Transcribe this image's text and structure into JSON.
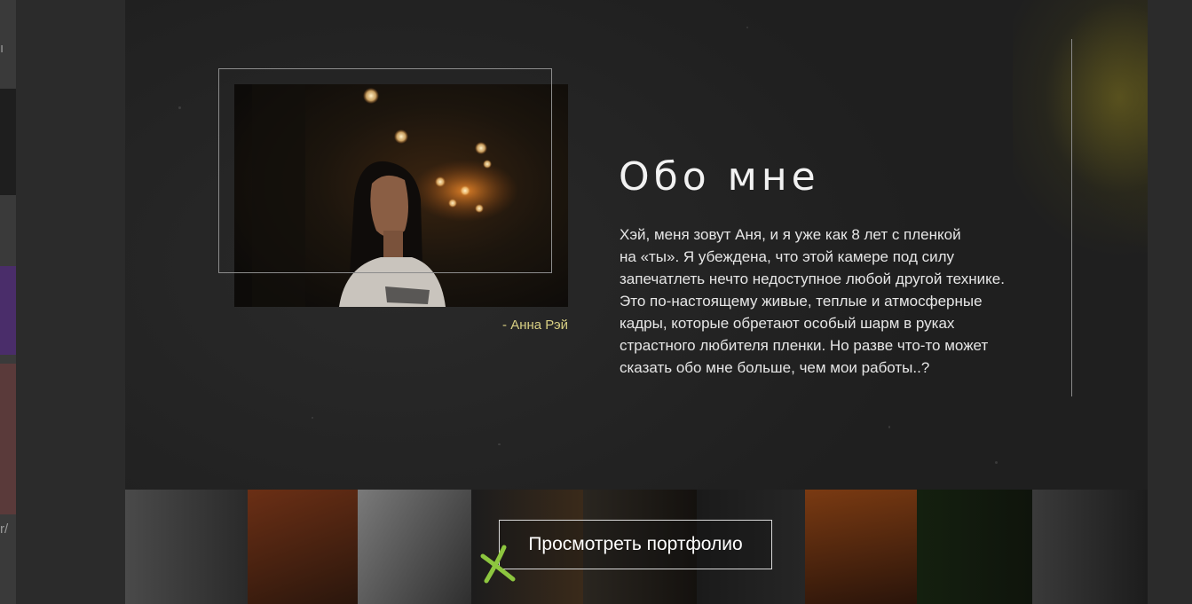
{
  "about": {
    "title": "Обо мне",
    "text": "Хэй, меня зовут Аня, и я уже как 8 лет с пленкой\nна «ты». Я убеждена, что этой камере под силу\nзапечатлеть нечто недоступное любой другой технике.\nЭто по-настоящему живые, теплые и атмосферные\nкадры, которые обретают особый шарм в руках\nстрастного любителя пленки. Но разве что-то может\nсказать обо мне больше, чем мои работы..?",
    "signature": "- Анна Рэй"
  },
  "portfolio": {
    "button_label": "Просмотреть портфолио"
  },
  "left_sidebar": {
    "char_top": "ı",
    "char_bottom": "r/"
  },
  "colors": {
    "accent_yellow": "#d8cf83",
    "accent_green": "#8dc63f",
    "background": "#262626"
  },
  "icons": {
    "cross": "green-cross-icon"
  }
}
